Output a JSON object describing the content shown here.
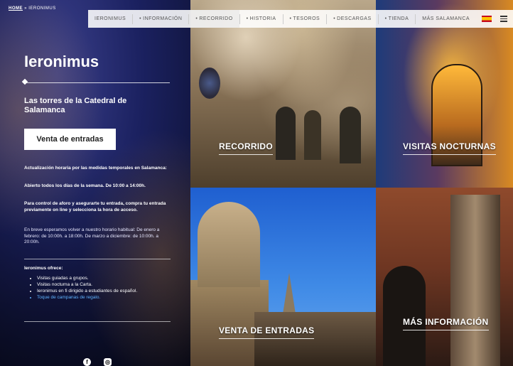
{
  "breadcrumb": {
    "home": "HOME",
    "sep": "»",
    "current": "IERONIMUS"
  },
  "nav": {
    "items": [
      {
        "label": "IERONIMUS"
      },
      {
        "label": "INFORMACIÓN"
      },
      {
        "label": "RECORRIDO"
      },
      {
        "label": "HISTORIA"
      },
      {
        "label": "TESOROS"
      },
      {
        "label": "DESCARGAS"
      },
      {
        "label": "TIENDA"
      },
      {
        "label": "MÁS SALAMANCA"
      }
    ],
    "bullet": "•",
    "language_flag": "spain-flag-icon"
  },
  "hero": {
    "title": "Ieronimus",
    "subtitle": "Las torres de la Catedral de Salamanca",
    "ticket_button": "Venta de entradas"
  },
  "info": {
    "notice": "Actualización horaria por las medidas temporales en Salamanca:",
    "hours": "Abierto todos los días de la semana. De 10:00 a 14:00h.",
    "capacity": "Para control de aforo y asegurarte tu entrada, compra tu entrada previamente on line y selecciona la hora de acceso.",
    "schedule": "En breve esperamos volver a nuestro horario habitual: De enero a febrero: de 10:00h. a 18:00h. De marzo a diciembre: de 10:00h. a 20:00h."
  },
  "offers": {
    "title": "Ieronimus ofrece:",
    "items": [
      "Visitas guiadas a grupos.",
      "Visitas nocturna a la Carta.",
      "Ieronimus en fi dirigido a estudiantes de español.",
      "Toque de campanas de regalo."
    ]
  },
  "tiles": {
    "recorrido": "RECORRIDO",
    "visitas": "VISITAS NOCTURNAS",
    "venta": "VENTA DE ENTRADAS",
    "mas_info": "MÁS INFORMACIÓN"
  },
  "social": {
    "facebook": "f",
    "instagram": "◎"
  }
}
